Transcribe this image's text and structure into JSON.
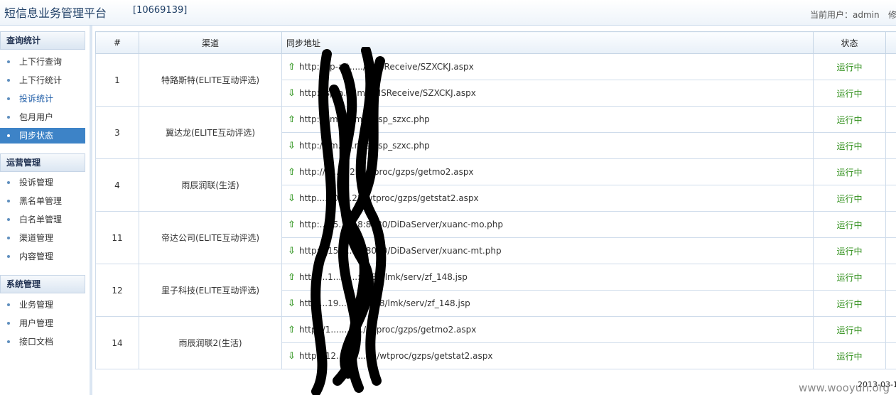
{
  "header": {
    "title": "短信息业务管理平台",
    "code": "[10669139]",
    "current_user": "当前用户：admin",
    "edit_label": "修"
  },
  "sidebar": {
    "groups": [
      {
        "title": "查询统计",
        "items": [
          "上下行查询",
          "上下行统计",
          "投诉统计",
          "包月用户",
          "同步状态"
        ]
      },
      {
        "title": "运营管理",
        "items": [
          "投诉管理",
          "黑名单管理",
          "白名单管理",
          "渠道管理",
          "内容管理"
        ]
      },
      {
        "title": "系统管理",
        "items": [
          "业务管理",
          "用户管理",
          "接口文档"
        ]
      }
    ],
    "active_item": "同步状态"
  },
  "table": {
    "headers": {
      "num": "#",
      "channel": "渠道",
      "url": "同步地址",
      "status": "状态"
    },
    "rows": [
      {
        "num": "1",
        "channel": "特路斯特(ELITE互动评选)",
        "up_url": "http://sp-a.t...../SMSReceive/SZXCKJ.aspx",
        "up_status": "运行中",
        "down_url": "http://sp-a.....m/SMSReceive/SZXCKJ.aspx",
        "down_status": "运行中"
      },
      {
        "num": "3",
        "channel": "翼达龙(ELITE互动评选)",
        "up_url": "http://sm......m/sp/sp_szxc.php",
        "up_status": "运行中",
        "down_url": "http://sm......m/sp/sp_szxc.php",
        "down_status": "运行中"
      },
      {
        "num": "4",
        "channel": "雨辰润联(生活)",
        "up_url": "http://1.......25/wtproc/gzps/getmo2.aspx",
        "up_status": "运行中",
        "down_url": "http....10.....25/wtproc/gzps/getstat2.aspx",
        "down_status": "运行中"
      },
      {
        "num": "11",
        "channel": "帝达公司(ELITE互动评选)",
        "up_url": "http:...15.......8:8080/DiDaServer/xuanc-mo.php",
        "up_status": "运行中",
        "down_url": "http:...15.......8:8080/DiDaServer/xuanc-mt.php",
        "down_status": "运行中"
      },
      {
        "num": "12",
        "channel": "里子科技(ELITE互动评选)",
        "up_url": "http:...1.........:8888/lmk/serv/zf_148.jsp",
        "up_status": "运行中",
        "down_url": "http:...19........:8888/lmk/serv/zf_148.jsp",
        "down_status": "运行中"
      },
      {
        "num": "14",
        "channel": "雨辰润联2(生活)",
        "up_url": "http://1.......1.../wtproc/gzps/getmo2.aspx",
        "up_status": "运行中",
        "down_url": "http://12....1.....25/wtproc/gzps/getstat2.aspx",
        "down_status": "运行中"
      }
    ]
  },
  "footer": {
    "date": "2013-03-1",
    "watermark": "www.wooyun.org"
  },
  "icons": {
    "up": "arrow-up-icon",
    "down": "arrow-down-icon"
  },
  "colors": {
    "active_bg": "#3d83c7",
    "status_green": "#2f8f1a",
    "arrow_green": "#3a9a2a"
  }
}
